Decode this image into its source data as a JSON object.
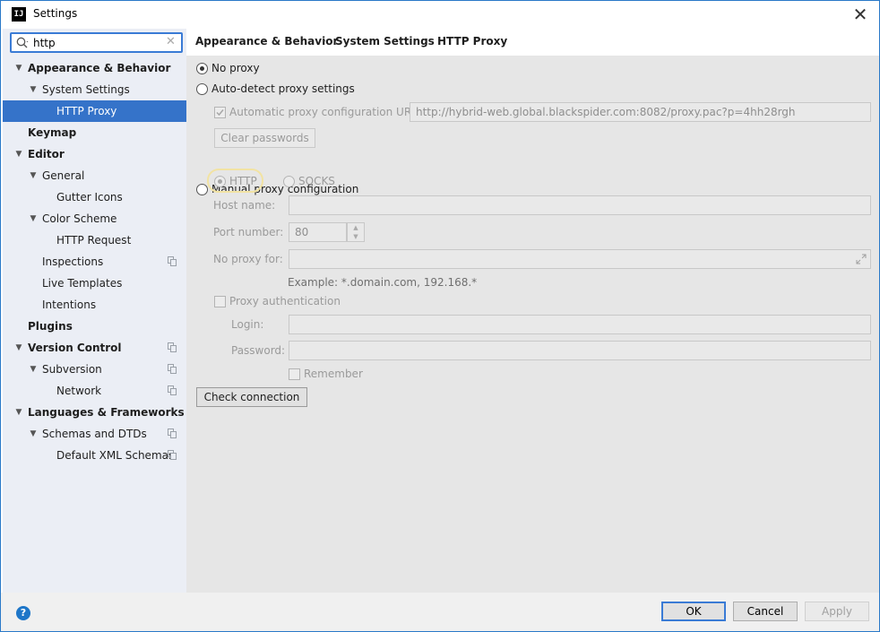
{
  "window": {
    "title": "Settings",
    "icon_text": "IJ"
  },
  "search": {
    "value": "http",
    "placeholder": ""
  },
  "tree": [
    {
      "label": "Appearance & Behavior",
      "bold": true,
      "expanded": true,
      "level": 0
    },
    {
      "label": "System Settings",
      "bold": false,
      "expanded": true,
      "level": 1
    },
    {
      "label": "HTTP Proxy",
      "bold": false,
      "level": 2,
      "selected": true
    },
    {
      "label": "Keymap",
      "bold": true,
      "level": 0
    },
    {
      "label": "Editor",
      "bold": true,
      "expanded": true,
      "level": 0
    },
    {
      "label": "General",
      "bold": false,
      "expanded": true,
      "level": 1
    },
    {
      "label": "Gutter Icons",
      "bold": false,
      "level": 2
    },
    {
      "label": "Color Scheme",
      "bold": false,
      "expanded": true,
      "level": 1
    },
    {
      "label": "HTTP Request",
      "bold": false,
      "level": 2
    },
    {
      "label": "Inspections",
      "bold": false,
      "level": 1,
      "copy_icon": true
    },
    {
      "label": "Live Templates",
      "bold": false,
      "level": 1
    },
    {
      "label": "Intentions",
      "bold": false,
      "level": 1
    },
    {
      "label": "Plugins",
      "bold": true,
      "level": 0
    },
    {
      "label": "Version Control",
      "bold": true,
      "expanded": true,
      "level": 0,
      "copy_icon": true
    },
    {
      "label": "Subversion",
      "bold": false,
      "expanded": true,
      "level": 1,
      "copy_icon": true
    },
    {
      "label": "Network",
      "bold": false,
      "level": 2,
      "copy_icon": true
    },
    {
      "label": "Languages & Frameworks",
      "bold": true,
      "expanded": true,
      "level": 0
    },
    {
      "label": "Schemas and DTDs",
      "bold": false,
      "expanded": true,
      "level": 1,
      "copy_icon": true
    },
    {
      "label": "Default XML Schemas",
      "bold": false,
      "level": 2,
      "copy_icon": true
    }
  ],
  "breadcrumb": [
    "Appearance & Behavior",
    "System Settings",
    "HTTP Proxy"
  ],
  "proxy": {
    "no_proxy": "No proxy",
    "auto_detect": "Auto-detect proxy settings",
    "auto_config_label": "Automatic proxy configuration URL:",
    "auto_config_url": "http://hybrid-web.global.blackspider.com:8082/proxy.pac?p=4hh28rgh",
    "clear_passwords": "Clear passwords",
    "manual": "Manual proxy configuration",
    "http": "HTTP",
    "socks": "SOCKS",
    "host_label": "Host name:",
    "host_value": "",
    "port_label": "Port number:",
    "port_value": "80",
    "no_proxy_for_label": "No proxy for:",
    "no_proxy_for_value": "",
    "example": "Example: *.domain.com, 192.168.*",
    "proxy_auth": "Proxy authentication",
    "login_label": "Login:",
    "login_value": "",
    "password_label": "Password:",
    "password_value": "",
    "remember": "Remember",
    "check_connection": "Check connection"
  },
  "footer": {
    "help": "?",
    "ok": "OK",
    "cancel": "Cancel",
    "apply": "Apply"
  },
  "colors": {
    "accent": "#3573c9",
    "sidebar_bg": "#ebeef5",
    "content_bg": "#e6e6e6"
  }
}
